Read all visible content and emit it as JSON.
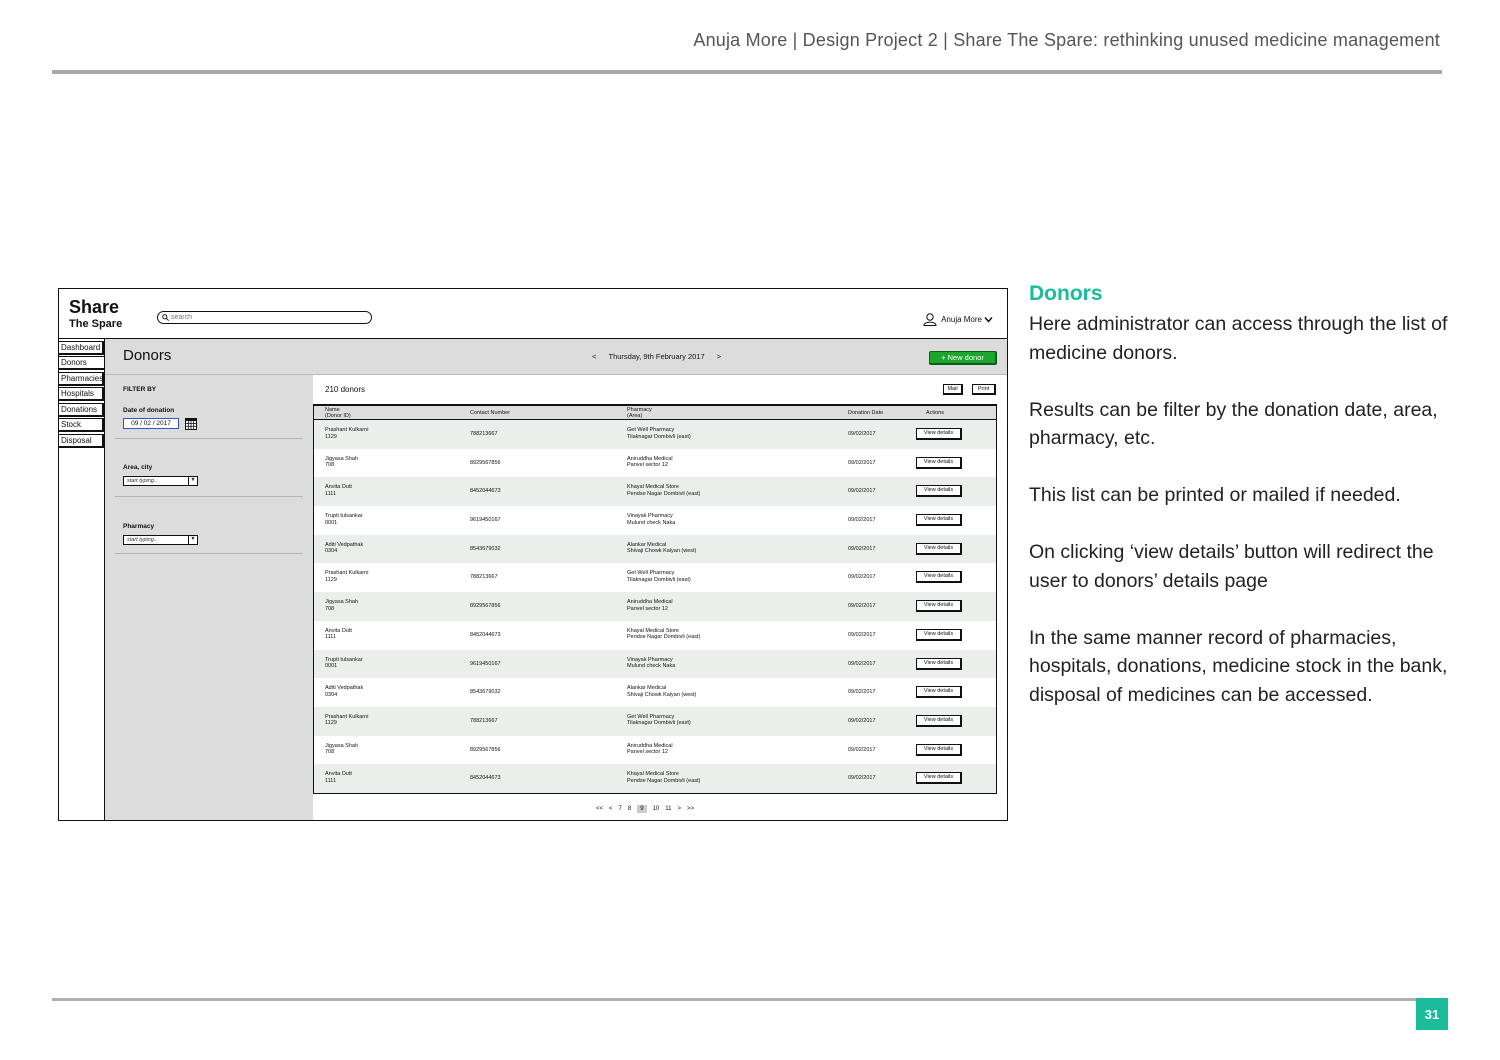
{
  "page": {
    "header": "Anuja More | Design Project 2 | Share The Spare: rethinking unused medicine management",
    "page_number": "31"
  },
  "description": {
    "title": "Donors",
    "paragraphs": [
      "Here administrator can access through the list of medicine donors.",
      "Results can be filter by the donation date, area, pharmacy, etc.",
      "This list can be printed or mailed if needed.",
      "On clicking ‘view details’ button will redirect the user to donors’ details page",
      "In the same manner record of pharmacies, hospitals, donations, medicine stock in the bank, disposal of medicines can be accessed."
    ]
  },
  "app": {
    "logo_line1": "Share",
    "logo_line2": "The Spare",
    "search_placeholder": "search",
    "user_name": "Anuja More",
    "nav": [
      "Dashboard",
      "Donors",
      "Pharmacies",
      "Hospitals",
      "Donations",
      "Stock",
      "Disposal"
    ],
    "title": "Donors",
    "date_prev": "<",
    "date": "Thursday, 9th February 2017",
    "date_next": ">",
    "new_donor": "+ New donor",
    "filter": {
      "title": "FILTER BY",
      "date_label": "Date of donation",
      "date_value": "09 / 02 /  2017",
      "area_label": "Area, city",
      "area_placeholder": "start typing..",
      "pharmacy_label": "Pharmacy",
      "pharmacy_placeholder": "start typing.."
    },
    "results_count": "210 donors",
    "mail": "Mail",
    "print": "Print",
    "columns": {
      "name": "Name",
      "name_sub": "(Donor ID)",
      "contact": "Contact Number",
      "pharmacy": "Pharmacy",
      "pharmacy_sub": "(Area)",
      "date": "Donation Date",
      "actions": "Actions"
    },
    "view_details": "View details",
    "rows": [
      {
        "name": "Prashant Kulkarni",
        "id": "1129",
        "contact": "788213667",
        "pharmacy": "Get Well Pharmacy",
        "area": "Tilaknagar Dombivli (east)",
        "date": "09/02/2017"
      },
      {
        "name": "Jigyasa Shah",
        "id": "708",
        "contact": "8929567856",
        "pharmacy": "Aniruddha Medical",
        "area": "Panvel sector 12",
        "date": "09/02/2017"
      },
      {
        "name": "Anvita Dutt",
        "id": "1111",
        "contact": "8452044673",
        "pharmacy": "Khayal Medical Store",
        "area": "Pendse Nagar Dombivli (east)",
        "date": "09/02/2017"
      },
      {
        "name": "Trupti tulsankar",
        "id": "0001",
        "contact": "9619450167",
        "pharmacy": "Vinayak Pharmacy",
        "area": "Mulund check Naka",
        "date": "09/02/2017"
      },
      {
        "name": "Aditi Vedpathak",
        "id": "0304",
        "contact": "8543679032",
        "pharmacy": "Alankar Medical",
        "area": "Shivaji Chowk Kalyan (west)",
        "date": "09/02/2017"
      },
      {
        "name": "Prashant Kulkarni",
        "id": "1129",
        "contact": "788213667",
        "pharmacy": "Get Well Pharmacy",
        "area": "Tilaknagar Dombivli (east)",
        "date": "09/02/2017"
      },
      {
        "name": "Jigyasa Shah",
        "id": "708",
        "contact": "8929567856",
        "pharmacy": "Aniruddha Medical",
        "area": "Panvel sector 12",
        "date": "09/02/2017"
      },
      {
        "name": "Anvita Dutt",
        "id": "1111",
        "contact": "8452044673",
        "pharmacy": "Khayal Medical Store",
        "area": "Pendse Nagar Dombivli (east)",
        "date": "09/02/2017"
      },
      {
        "name": "Trupti tulsankar",
        "id": "0001",
        "contact": "9619450167",
        "pharmacy": "Vinayak Pharmacy",
        "area": "Mulund check Naka",
        "date": "09/02/2017"
      },
      {
        "name": "Aditi Vedpathak",
        "id": "0304",
        "contact": "8543679032",
        "pharmacy": "Alankar Medical",
        "area": "Shivaji Chowk Kalyan (west)",
        "date": "09/02/2017"
      },
      {
        "name": "Prashant Kulkarni",
        "id": "1129",
        "contact": "788213667",
        "pharmacy": "Get Well Pharmacy",
        "area": "Tilaknagar Dombivli (east)",
        "date": "09/02/2017"
      },
      {
        "name": "Jigyasa Shah",
        "id": "708",
        "contact": "8929567856",
        "pharmacy": "Aniruddha Medical",
        "area": "Panvel sector 12",
        "date": "09/02/2017"
      },
      {
        "name": "Anvita Dutt",
        "id": "1111",
        "contact": "8452044673",
        "pharmacy": "Khayal Medical Store",
        "area": "Pendse Nagar Dombivli (east)",
        "date": "09/02/2017"
      }
    ],
    "pagination": [
      "<<",
      "<",
      "7",
      "8",
      "9",
      "10",
      "11",
      ">",
      ">>"
    ],
    "current_page": "9"
  },
  "colors": {
    "accent": "#1abc9c",
    "new_donor_button": "#1ea52f",
    "panel_gray": "#dcdcdc",
    "row_alt": "#eaefec"
  }
}
